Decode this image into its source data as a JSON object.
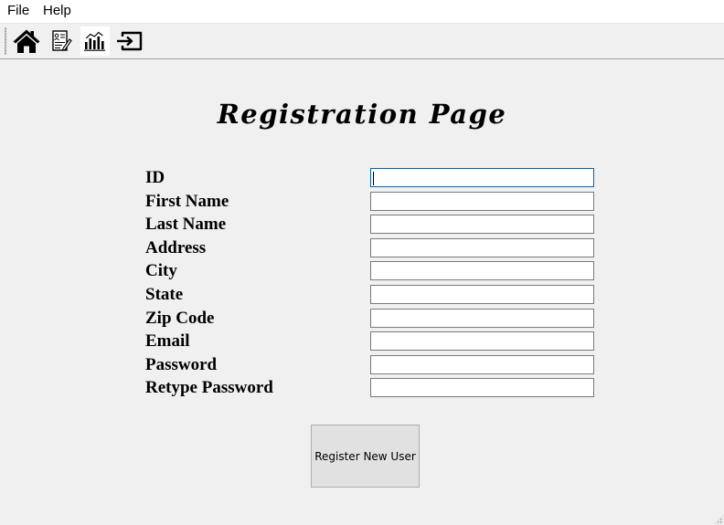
{
  "menubar": {
    "items": [
      {
        "label": "File"
      },
      {
        "label": "Help"
      }
    ]
  },
  "toolbar": {
    "buttons": [
      {
        "icon": "home-icon"
      },
      {
        "icon": "registration-form-icon"
      },
      {
        "icon": "bar-chart-icon"
      },
      {
        "icon": "logout-icon"
      }
    ]
  },
  "page": {
    "title": "Registration Page"
  },
  "form": {
    "fields": [
      {
        "label": "ID",
        "value": ""
      },
      {
        "label": "First Name",
        "value": ""
      },
      {
        "label": "Last Name",
        "value": ""
      },
      {
        "label": "Address",
        "value": ""
      },
      {
        "label": "City",
        "value": ""
      },
      {
        "label": "State",
        "value": ""
      },
      {
        "label": "Zip Code",
        "value": ""
      },
      {
        "label": "Email",
        "value": ""
      },
      {
        "label": "Password",
        "value": ""
      },
      {
        "label": "Retype Password",
        "value": ""
      }
    ],
    "submit_label": "Register New User"
  },
  "colors": {
    "window_bg": "#f0f0f0",
    "focus_border": "#0063b1",
    "button_bg": "#e1e1e1"
  }
}
